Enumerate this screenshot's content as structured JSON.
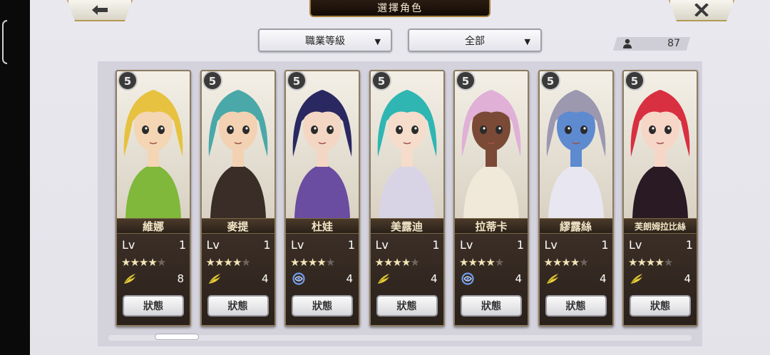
{
  "header": {
    "title": "選擇角色",
    "back_icon": "back-arrow-icon",
    "close_icon": "close-x-icon"
  },
  "filters": {
    "job_level_label": "職業等級",
    "category_label": "全部"
  },
  "character_count": "87",
  "lv_label": "Lv",
  "status_label": "狀態",
  "characters": [
    {
      "name": "維娜",
      "lv": "1",
      "stars": 4,
      "max_stars": 5,
      "element": "wind",
      "element_count": "8",
      "hair": "#e6c240",
      "skin": "#f4d6b4",
      "outfit": "#7fb83a"
    },
    {
      "name": "麥提",
      "lv": "1",
      "stars": 4,
      "max_stars": 5,
      "element": "wind",
      "element_count": "4",
      "hair": "#4aa8a8",
      "skin": "#f2d2b2",
      "outfit": "#3a2c26"
    },
    {
      "name": "杜娃",
      "lv": "1",
      "stars": 4,
      "max_stars": 5,
      "element": "water",
      "element_count": "4",
      "hair": "#2a2860",
      "skin": "#f3d7c4",
      "outfit": "#6a4ca0"
    },
    {
      "name": "美露迪",
      "lv": "1",
      "stars": 4,
      "max_stars": 5,
      "element": "wind",
      "element_count": "4",
      "hair": "#2fb6b2",
      "skin": "#f6dccb",
      "outfit": "#d8d4e6"
    },
    {
      "name": "拉蒂卡",
      "lv": "1",
      "stars": 4,
      "max_stars": 5,
      "element": "water",
      "element_count": "4",
      "hair": "#e0b0d6",
      "skin": "#7a4a36",
      "outfit": "#f0e8d8"
    },
    {
      "name": "繆露絲",
      "lv": "1",
      "stars": 4,
      "max_stars": 5,
      "element": "wind",
      "element_count": "4",
      "hair": "#9c98b0",
      "skin": "#5e8ad0",
      "outfit": "#e8e6f0"
    },
    {
      "name": "芙朗姆拉比絲",
      "lv": "1",
      "stars": 4,
      "max_stars": 5,
      "element": "wind",
      "element_count": "4",
      "hair": "#d83040",
      "skin": "#f6d6c6",
      "outfit": "#2a1a24"
    }
  ]
}
